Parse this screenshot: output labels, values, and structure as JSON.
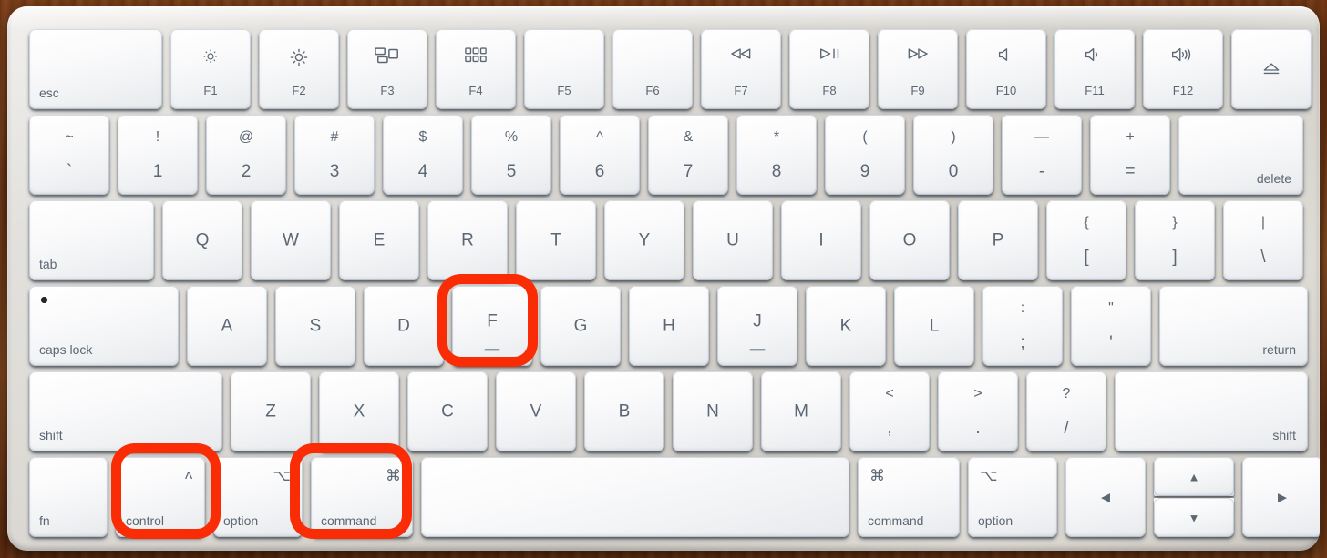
{
  "scene": {
    "subject": "Apple Magic Keyboard photographed on a wooden desk",
    "annotation_color": "#fa2c06",
    "annotated_keys": [
      "control",
      "command",
      "F"
    ],
    "shortcut": "control-command-F",
    "desk_color": "#74390f",
    "chassis_color": "#d8d5d0",
    "key_color": "#f6f7f8",
    "legend_color": "#5c6773"
  },
  "rows": {
    "function": [
      {
        "name": "esc",
        "label": "esc"
      },
      {
        "name": "f1",
        "fn": "F1",
        "icon": "brightness-down-icon"
      },
      {
        "name": "f2",
        "fn": "F2",
        "icon": "brightness-up-icon"
      },
      {
        "name": "f3",
        "fn": "F3",
        "icon": "mission-control-icon"
      },
      {
        "name": "f4",
        "fn": "F4",
        "icon": "launchpad-icon"
      },
      {
        "name": "f5",
        "fn": "F5",
        "icon": ""
      },
      {
        "name": "f6",
        "fn": "F6",
        "icon": ""
      },
      {
        "name": "f7",
        "fn": "F7",
        "icon": "rewind-icon"
      },
      {
        "name": "f8",
        "fn": "F8",
        "icon": "play-pause-icon"
      },
      {
        "name": "f9",
        "fn": "F9",
        "icon": "fast-forward-icon"
      },
      {
        "name": "f10",
        "fn": "F10",
        "icon": "mute-icon"
      },
      {
        "name": "f11",
        "fn": "F11",
        "icon": "volume-down-icon"
      },
      {
        "name": "f12",
        "fn": "F12",
        "icon": "volume-up-icon"
      },
      {
        "name": "eject",
        "fn": "",
        "icon": "eject-icon"
      }
    ],
    "number": [
      {
        "name": "grave",
        "top": "~",
        "bottom": "`"
      },
      {
        "name": "1",
        "top": "!",
        "bottom": "1"
      },
      {
        "name": "2",
        "top": "@",
        "bottom": "2"
      },
      {
        "name": "3",
        "top": "#",
        "bottom": "3"
      },
      {
        "name": "4",
        "top": "$",
        "bottom": "4"
      },
      {
        "name": "5",
        "top": "%",
        "bottom": "5"
      },
      {
        "name": "6",
        "top": "^",
        "bottom": "6"
      },
      {
        "name": "7",
        "top": "&",
        "bottom": "7"
      },
      {
        "name": "8",
        "top": "*",
        "bottom": "8"
      },
      {
        "name": "9",
        "top": "(",
        "bottom": "9"
      },
      {
        "name": "0",
        "top": ")",
        "bottom": "0"
      },
      {
        "name": "minus",
        "top": "—",
        "bottom": "-"
      },
      {
        "name": "equal",
        "top": "+",
        "bottom": "="
      },
      {
        "name": "delete",
        "label": "delete"
      }
    ],
    "top": [
      {
        "name": "tab",
        "label": "tab"
      },
      {
        "name": "q",
        "label": "Q"
      },
      {
        "name": "w",
        "label": "W"
      },
      {
        "name": "e",
        "label": "E"
      },
      {
        "name": "r",
        "label": "R"
      },
      {
        "name": "t",
        "label": "T"
      },
      {
        "name": "y",
        "label": "Y"
      },
      {
        "name": "u",
        "label": "U"
      },
      {
        "name": "i",
        "label": "I"
      },
      {
        "name": "o",
        "label": "O"
      },
      {
        "name": "p",
        "label": "P"
      },
      {
        "name": "bracket-left",
        "top": "{",
        "bottom": "["
      },
      {
        "name": "bracket-right",
        "top": "}",
        "bottom": "]"
      },
      {
        "name": "backslash",
        "top": "|",
        "bottom": "\\"
      }
    ],
    "home": [
      {
        "name": "caps-lock",
        "label": "caps lock"
      },
      {
        "name": "a",
        "label": "A"
      },
      {
        "name": "s",
        "label": "S"
      },
      {
        "name": "d",
        "label": "D"
      },
      {
        "name": "f",
        "label": "F"
      },
      {
        "name": "g",
        "label": "G"
      },
      {
        "name": "h",
        "label": "H"
      },
      {
        "name": "j",
        "label": "J"
      },
      {
        "name": "k",
        "label": "K"
      },
      {
        "name": "l",
        "label": "L"
      },
      {
        "name": "semicolon",
        "top": ":",
        "bottom": ";"
      },
      {
        "name": "quote",
        "top": "\"",
        "bottom": "'"
      },
      {
        "name": "return",
        "label": "return"
      }
    ],
    "shift": [
      {
        "name": "shift-left",
        "label": "shift"
      },
      {
        "name": "z",
        "label": "Z"
      },
      {
        "name": "x",
        "label": "X"
      },
      {
        "name": "c",
        "label": "C"
      },
      {
        "name": "v",
        "label": "V"
      },
      {
        "name": "b",
        "label": "B"
      },
      {
        "name": "n",
        "label": "N"
      },
      {
        "name": "m",
        "label": "M"
      },
      {
        "name": "comma",
        "top": "<",
        "bottom": ","
      },
      {
        "name": "period",
        "top": ">",
        "bottom": "."
      },
      {
        "name": "slash",
        "top": "?",
        "bottom": "/"
      },
      {
        "name": "shift-right",
        "label": "shift"
      }
    ],
    "bottom": [
      {
        "name": "fn",
        "label": "fn",
        "symbol": ""
      },
      {
        "name": "control",
        "label": "control",
        "symbol": "˄"
      },
      {
        "name": "option-left",
        "label": "option",
        "symbol": "⌥"
      },
      {
        "name": "command-left",
        "label": "command",
        "symbol": "⌘"
      },
      {
        "name": "space",
        "label": "",
        "symbol": ""
      },
      {
        "name": "command-right",
        "label": "command",
        "symbol": "⌘"
      },
      {
        "name": "option-right",
        "label": "option",
        "symbol": "⌥"
      },
      {
        "name": "arrow-left",
        "label": "",
        "symbol": "◀"
      },
      {
        "name": "arrow-up",
        "label": "",
        "symbol": "▲"
      },
      {
        "name": "arrow-down",
        "label": "",
        "symbol": "▼"
      },
      {
        "name": "arrow-right",
        "label": "",
        "symbol": "▶"
      }
    ]
  }
}
